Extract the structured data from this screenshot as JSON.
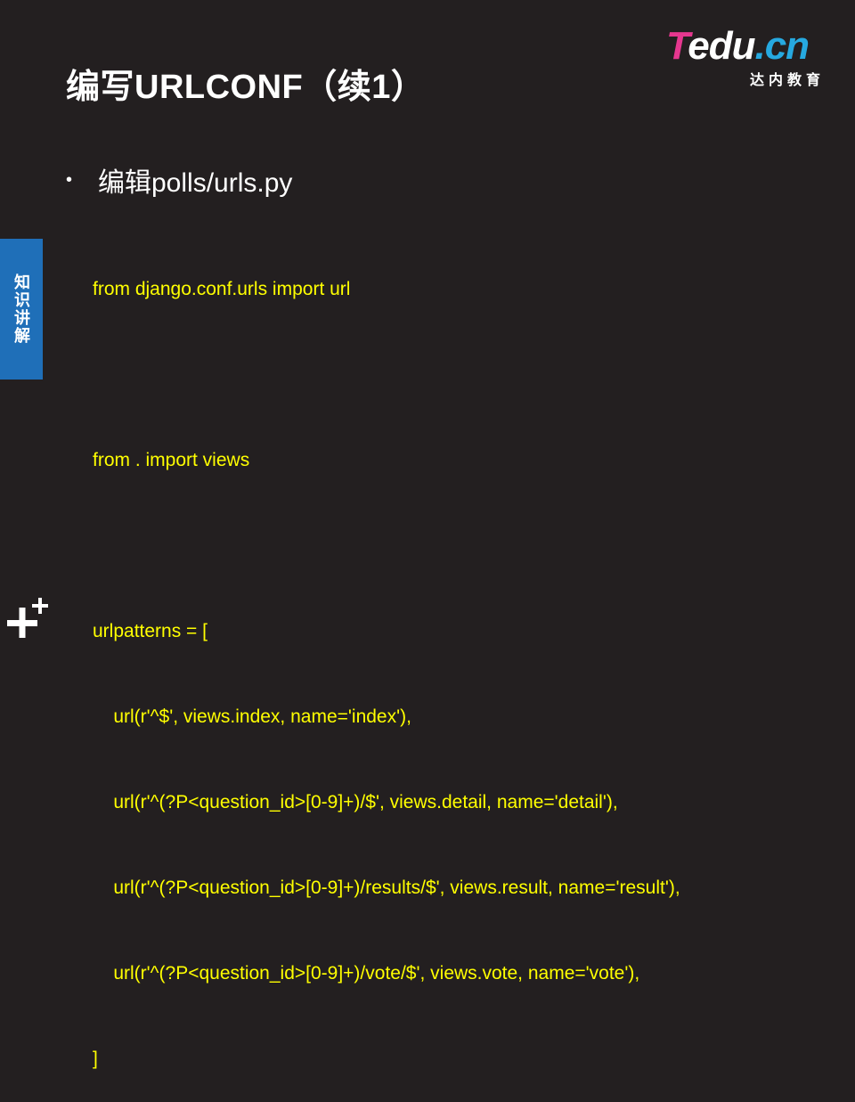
{
  "slide": {
    "title": "编写URLCONF（续1）"
  },
  "logo": {
    "brand_part1": "T",
    "brand_part2": "edu",
    "brand_part3": ".cn",
    "subtitle": "达内教育"
  },
  "bullet": {
    "text": "编辑polls/urls.py"
  },
  "code": {
    "lines": [
      "from django.conf.urls import url",
      "",
      "from . import views",
      "",
      "urlpatterns = [",
      "    url(r'^$', views.index, name='index'),",
      "    url(r'^(?P<question_id>[0-9]+)/$', views.detail, name='detail'),",
      "    url(r'^(?P<question_id>[0-9]+)/results/$', views.result, name='result'),",
      "    url(r'^(?P<question_id>[0-9]+)/vote/$', views.vote, name='vote'),",
      "]"
    ]
  },
  "side_tab": {
    "label": "知识讲解"
  },
  "icons": {
    "corner": "plus-plus-icon"
  },
  "colors": {
    "background": "#231f20",
    "code_text": "#ffff00",
    "side_tab": "#1f6fb8",
    "logo_pink": "#e6378f",
    "logo_blue": "#26a9e0"
  }
}
